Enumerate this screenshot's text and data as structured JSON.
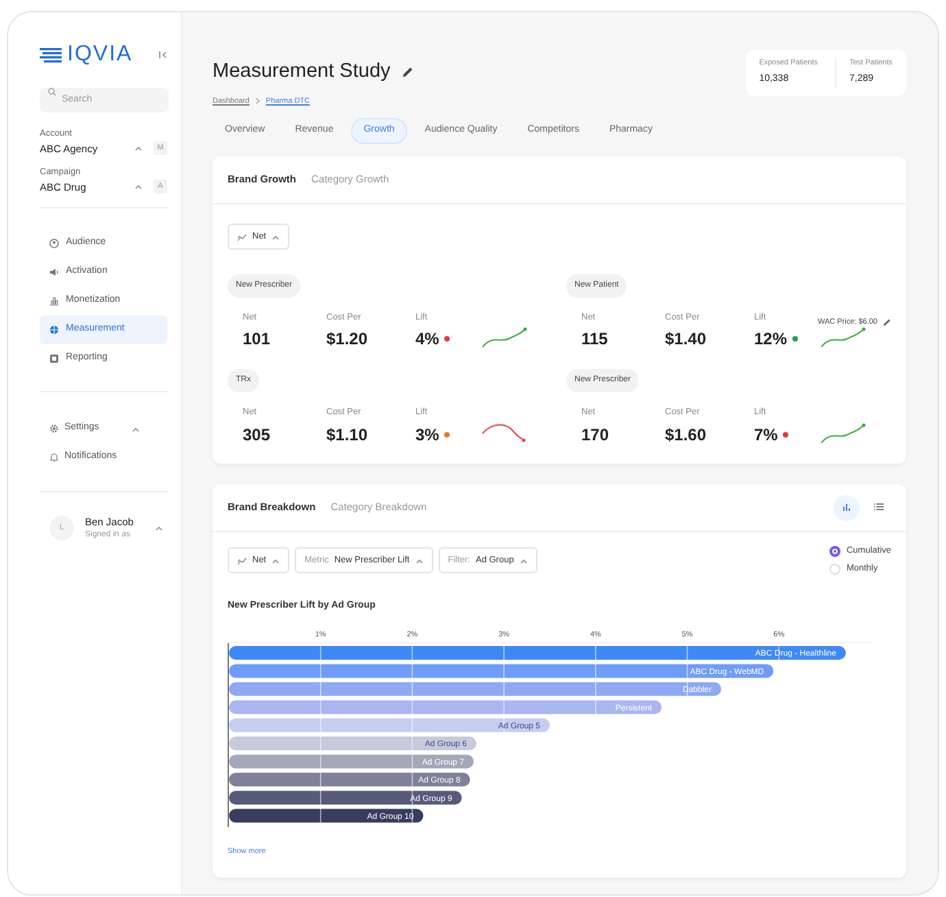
{
  "sidebar": {
    "logo": "IQVIA",
    "search": {
      "placeholder": "Search"
    },
    "selectors": [
      {
        "label": "Account",
        "value": "ABC Agency",
        "badge": "M"
      },
      {
        "label": "Campaign",
        "value": "ABC Drug",
        "badge": "A"
      }
    ],
    "nav": [
      {
        "label": "Audience",
        "kind": "audience",
        "selected": false
      },
      {
        "label": "Activation",
        "kind": "activation",
        "selected": false
      },
      {
        "label": "Monetization",
        "kind": "monetization",
        "selected": false
      },
      {
        "label": "Measurement",
        "kind": "measurement",
        "selected": true
      },
      {
        "label": "Reporting",
        "kind": "reporting",
        "selected": false
      }
    ],
    "settings": [
      {
        "label": "Settings",
        "kind": "gear",
        "expandable": true
      },
      {
        "label": "Notifications",
        "kind": "bell",
        "expandable": false
      }
    ],
    "user": {
      "initial": "L",
      "name": "Ben Jacob",
      "subtitle": "Signed in as"
    }
  },
  "header": {
    "title": "Measurement Study",
    "breadcrumb": [
      {
        "label": "Dashboard",
        "current": false
      },
      {
        "label": "Pharma DTC",
        "current": true
      }
    ],
    "stats": [
      {
        "label": "Exposed Patients",
        "value": "10,338"
      },
      {
        "label": "Test Patients",
        "value": "7,289"
      }
    ]
  },
  "tabs": [
    {
      "label": "Overview",
      "selected": false
    },
    {
      "label": "Revenue",
      "selected": false
    },
    {
      "label": "Growth",
      "selected": true
    },
    {
      "label": "Audience Quality",
      "selected": false
    },
    {
      "label": "Competitors",
      "selected": false
    },
    {
      "label": "Pharmacy",
      "selected": false
    }
  ],
  "growth_card": {
    "tabs": [
      {
        "label": "Brand Growth",
        "selected": true
      },
      {
        "label": "Category Growth",
        "selected": false
      }
    ],
    "mode": "Net",
    "metrics": [
      {
        "title": "New Prescriber",
        "kind": "up",
        "fields": [
          {
            "label": "Net",
            "value": "101"
          },
          {
            "label": "Cost Per",
            "value": "$1.20"
          },
          {
            "label": "Lift",
            "value": "4%",
            "color": "#e5383b"
          }
        ]
      },
      {
        "title": "New Patient",
        "kind": "up",
        "wac": "WAC Price: $6.00",
        "fields": [
          {
            "label": "Net",
            "value": "115"
          },
          {
            "label": "Cost Per",
            "value": "$1.40"
          },
          {
            "label": "Lift",
            "value": "12%",
            "color": "#1aa35a"
          }
        ]
      },
      {
        "title": "TRx",
        "kind": "down",
        "fields": [
          {
            "label": "Net",
            "value": "305"
          },
          {
            "label": "Cost Per",
            "value": "$1.10"
          },
          {
            "label": "Lift",
            "value": "3%",
            "color": "#f07a1a"
          }
        ]
      },
      {
        "title": "New Prescriber",
        "kind": "up",
        "fields": [
          {
            "label": "Net",
            "value": "170"
          },
          {
            "label": "Cost Per",
            "value": "$1.60"
          },
          {
            "label": "Lift",
            "value": "7%",
            "color": "#e5383b"
          }
        ]
      }
    ]
  },
  "breakdown_card": {
    "tabs": [
      {
        "label": "Brand Breakdown",
        "selected": true
      },
      {
        "label": "Category Breakdown",
        "selected": false
      }
    ],
    "view_buttons": [
      {
        "kind": "chart",
        "selected": true
      },
      {
        "kind": "list",
        "selected": false
      }
    ],
    "filters": [
      {
        "kind": "mode",
        "value": "Net"
      },
      {
        "kind": "labeled",
        "label": "Metric",
        "value": "New Prescriber Lift"
      },
      {
        "kind": "labeled",
        "label": "Filter:",
        "value": "Ad Group"
      }
    ],
    "options": [
      {
        "label": "Cumulative",
        "selected": true
      },
      {
        "label": "Monthly",
        "selected": false
      }
    ],
    "chart_data": {
      "type": "bar",
      "orientation": "horizontal",
      "title": "New Prescriber Lift by Ad Group",
      "grid": true,
      "categories": [
        "ABC Drug - Healthline",
        "ABC Drug - WebMD",
        "Dabbler",
        "Persistent",
        "Ad Group 5",
        "Ad Group 6",
        "Ad Group 7",
        "Ad Group 8",
        "Ad Group 9",
        "Ad Group 10"
      ],
      "colors": [
        "#3f88f7",
        "#6f9cf7",
        "#8ea8f4",
        "#a9b6ef",
        "#c5cdf0",
        "#c7cad9",
        "#a4a7b8",
        "#7f8199",
        "#575a78",
        "#373d5e"
      ],
      "xlim": [
        0,
        7
      ],
      "values": [
        6.73,
        5.94,
        5.37,
        4.72,
        3.5,
        2.7,
        2.67,
        2.63,
        2.54,
        2.12
      ],
      "xticks": [
        {
          "value": 1,
          "label": "1%"
        },
        {
          "value": 2,
          "label": "2%"
        },
        {
          "value": 3,
          "label": "3%"
        },
        {
          "value": 4,
          "label": "4%"
        },
        {
          "value": 5,
          "label": "5%"
        },
        {
          "value": 6,
          "label": "6%"
        }
      ]
    },
    "show_more": "Show more"
  }
}
